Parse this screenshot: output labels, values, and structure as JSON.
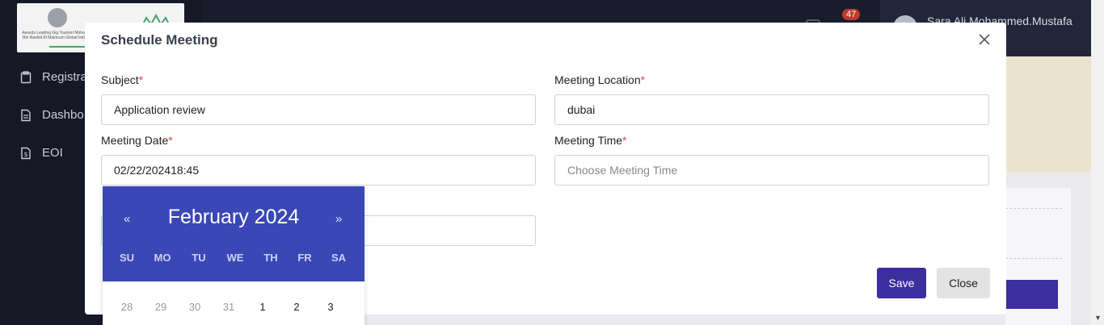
{
  "sidebar": {
    "logo_text": "Awards Leading Gig Tourism Mohammed Bin Rashid Al Maktoum Global Initiatives",
    "items": [
      {
        "label": "Registra",
        "icon": "clipboard-icon"
      },
      {
        "label": "Dashbo",
        "icon": "document-icon"
      },
      {
        "label": "EOI",
        "icon": "file-dollar-icon"
      }
    ]
  },
  "topbar": {
    "notification_count": "47",
    "user_name": "Sara Ali Mohammed.Mustafa"
  },
  "modal": {
    "title": "Schedule Meeting",
    "subject_label": "Subject",
    "subject_value": "Application review",
    "location_label": "Meeting Location",
    "location_value": "dubai",
    "date_label": "Meeting Date",
    "date_value": "02/22/202418:45",
    "time_label": "Meeting Time",
    "time_placeholder": "Choose Meeting Time",
    "required_mark": "*",
    "save_label": "Save",
    "close_label": "Close"
  },
  "datepicker": {
    "prev": "«",
    "next": "»",
    "month_label": "February 2024",
    "weekdays": [
      "SU",
      "MO",
      "TU",
      "WE",
      "TH",
      "FR",
      "SA"
    ],
    "first_week": [
      "28",
      "29",
      "30",
      "31",
      "1",
      "2",
      "3"
    ]
  },
  "colors": {
    "primary": "#3d2d9e",
    "datepicker_header": "#3a47b5",
    "required": "#e04545",
    "badge": "#c0392b"
  }
}
